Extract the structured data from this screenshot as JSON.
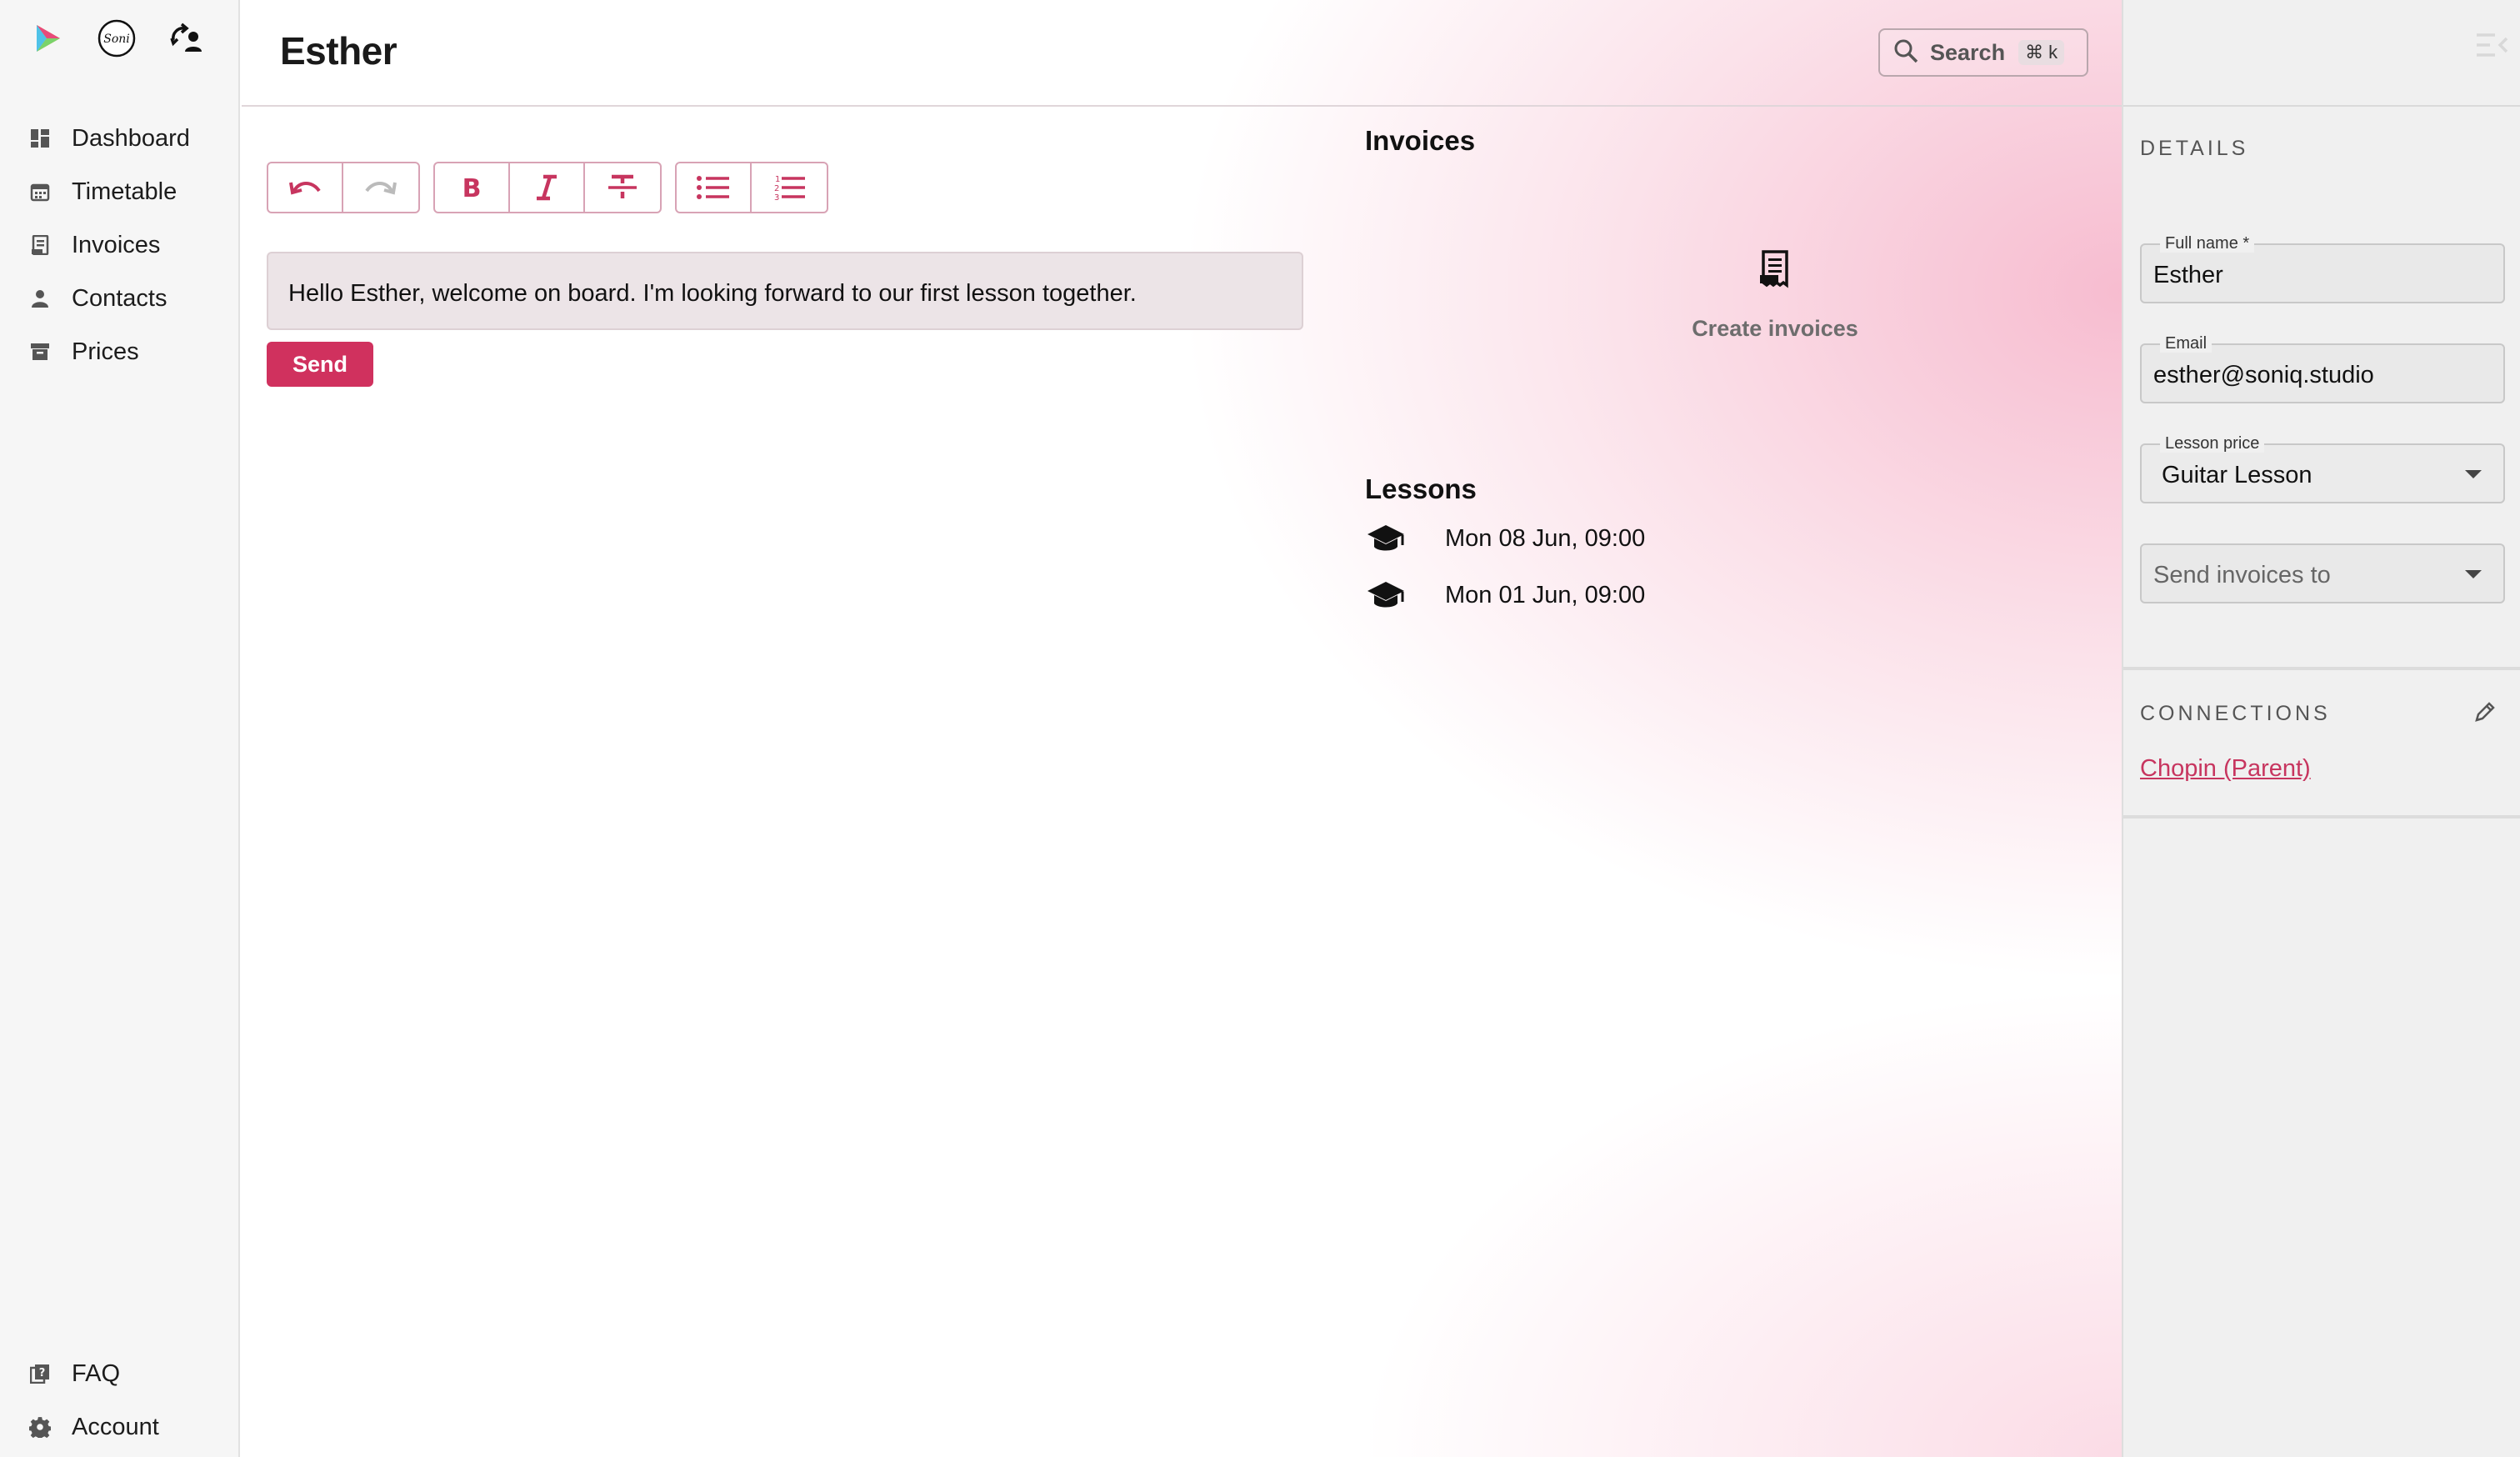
{
  "sidebar": {
    "apps": [
      {
        "name": "play-logo-icon"
      },
      {
        "name": "soni-logo-icon"
      },
      {
        "name": "switch-account-icon"
      }
    ],
    "items": [
      {
        "label": "Dashboard",
        "icon": "dashboard-icon"
      },
      {
        "label": "Timetable",
        "icon": "calendar-icon"
      },
      {
        "label": "Invoices",
        "icon": "invoice-icon"
      },
      {
        "label": "Contacts",
        "icon": "person-icon"
      },
      {
        "label": "Prices",
        "icon": "archive-icon"
      }
    ],
    "footer": [
      {
        "label": "FAQ",
        "icon": "faq-icon"
      },
      {
        "label": "Account",
        "icon": "gear-icon"
      }
    ]
  },
  "header": {
    "title": "Esther",
    "search_label": "Search",
    "search_shortcut": "⌘ k"
  },
  "editor": {
    "toolbar": [
      "undo-icon",
      "redo-icon",
      "bold-icon",
      "italic-icon",
      "strikethrough-icon",
      "bullet-list-icon",
      "numbered-list-icon"
    ],
    "message": "Hello Esther, welcome on board. I'm looking forward to our first lesson together.",
    "send_label": "Send"
  },
  "invoices": {
    "heading": "Invoices",
    "create_label": "Create invoices"
  },
  "lessons": {
    "heading": "Lessons",
    "items": [
      {
        "date": "Mon 08 Jun, 09:00"
      },
      {
        "date": "Mon 01 Jun, 09:00"
      }
    ]
  },
  "details": {
    "heading": "DETAILS",
    "full_name_label": "Full name *",
    "full_name_value": "Esther",
    "email_label": "Email",
    "email_value": "esther@soniq.studio",
    "lesson_price_label": "Lesson price",
    "lesson_price_value": "Guitar Lesson",
    "send_invoices_placeholder": "Send invoices to"
  },
  "connections": {
    "heading": "CONNECTIONS",
    "items": [
      {
        "label": "Chopin (Parent)"
      }
    ]
  },
  "colors": {
    "accent": "#d0315e",
    "link": "#c7355f",
    "sidebar_bg": "#f6f6f6",
    "panel_bg": "#f0f0f0"
  }
}
